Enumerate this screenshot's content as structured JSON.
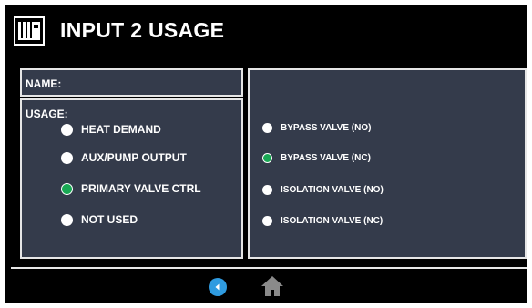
{
  "header": {
    "title": "INPUT 2 USAGE",
    "logo_icon": "boiler-logo-icon"
  },
  "name_field": {
    "label": "NAME:",
    "value": ""
  },
  "usage": {
    "label": "USAGE:",
    "options": [
      {
        "label": "HEAT DEMAND",
        "selected": false
      },
      {
        "label": "AUX/PUMP OUTPUT",
        "selected": false
      },
      {
        "label": "PRIMARY VALVE CTRL",
        "selected": true
      },
      {
        "label": "NOT USED",
        "selected": false
      }
    ]
  },
  "valve": {
    "options": [
      {
        "label": "BYPASS VALVE (NO)",
        "selected": false
      },
      {
        "label": "BYPASS VALVE (NC)",
        "selected": true
      },
      {
        "label": "ISOLATION VALVE (NO)",
        "selected": false
      },
      {
        "label": "ISOLATION VALVE (NC)",
        "selected": false
      }
    ]
  },
  "footer": {
    "back_icon": "back-arrow-icon",
    "home_icon": "home-icon"
  },
  "colors": {
    "background": "#000000",
    "panel": "#343b4b",
    "border": "#e6e6e6",
    "selected_radio": "#19a854",
    "back_button": "#2f9be0",
    "home_icon": "#8a8a8a"
  }
}
